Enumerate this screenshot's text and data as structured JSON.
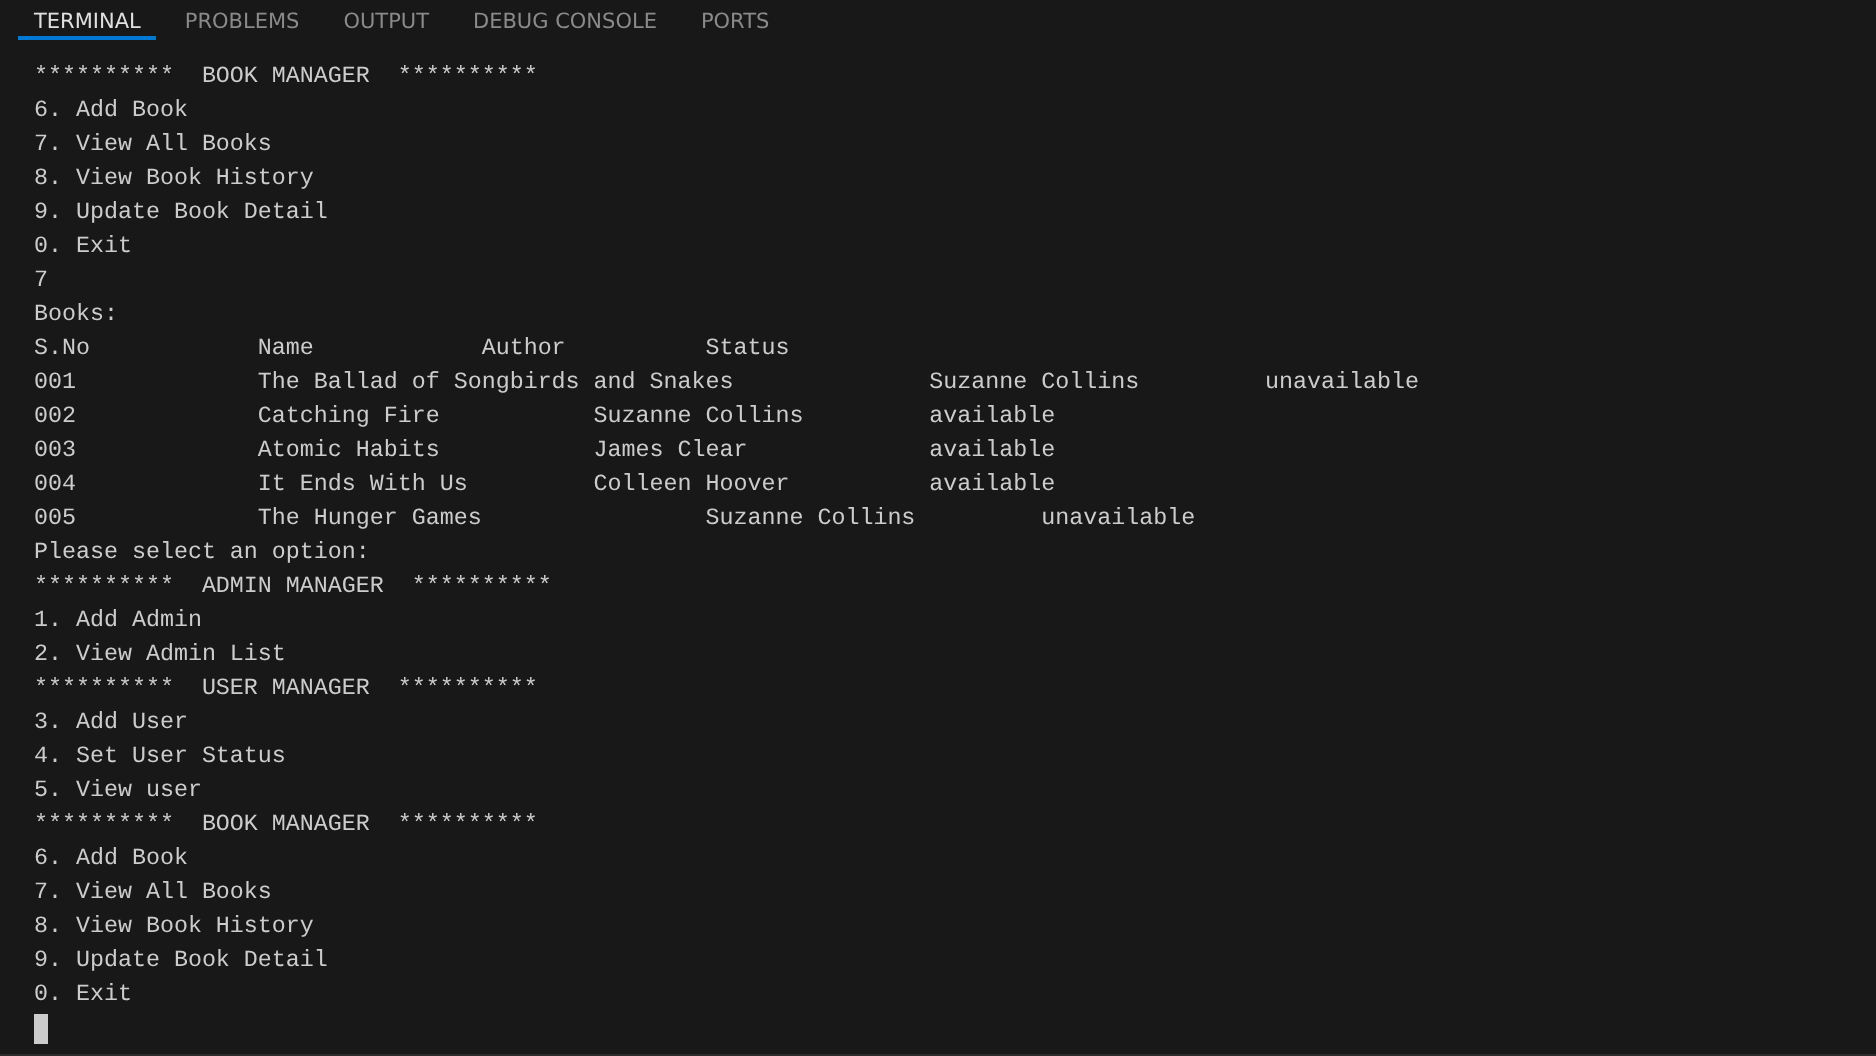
{
  "tabs": [
    {
      "label": "TERMINAL",
      "selected": true
    },
    {
      "label": "PROBLEMS",
      "selected": false
    },
    {
      "label": "OUTPUT",
      "selected": false
    },
    {
      "label": "DEBUG CONSOLE",
      "selected": false
    },
    {
      "label": "PORTS",
      "selected": false
    }
  ],
  "terminal_lines": [
    "**********  BOOK MANAGER  **********",
    "6. Add Book",
    "7. View All Books",
    "8. View Book History",
    "9. Update Book Detail",
    "0. Exit",
    "7",
    "Books:",
    "S.No            Name            Author          Status",
    "001             The Ballad of Songbirds and Snakes              Suzanne Collins         unavailable",
    "002             Catching Fire           Suzanne Collins         available",
    "003             Atomic Habits           James Clear             available",
    "004             It Ends With Us         Colleen Hoover          available",
    "005             The Hunger Games                Suzanne Collins         unavailable",
    "Please select an option:",
    "**********  ADMIN MANAGER  **********",
    "1. Add Admin",
    "2. View Admin List",
    "**********  USER MANAGER  **********",
    "3. Add User",
    "4. Set User Status",
    "5. View user",
    "**********  BOOK MANAGER  **********",
    "6. Add Book",
    "7. View All Books",
    "8. View Book History",
    "9. Update Book Detail",
    "0. Exit"
  ]
}
